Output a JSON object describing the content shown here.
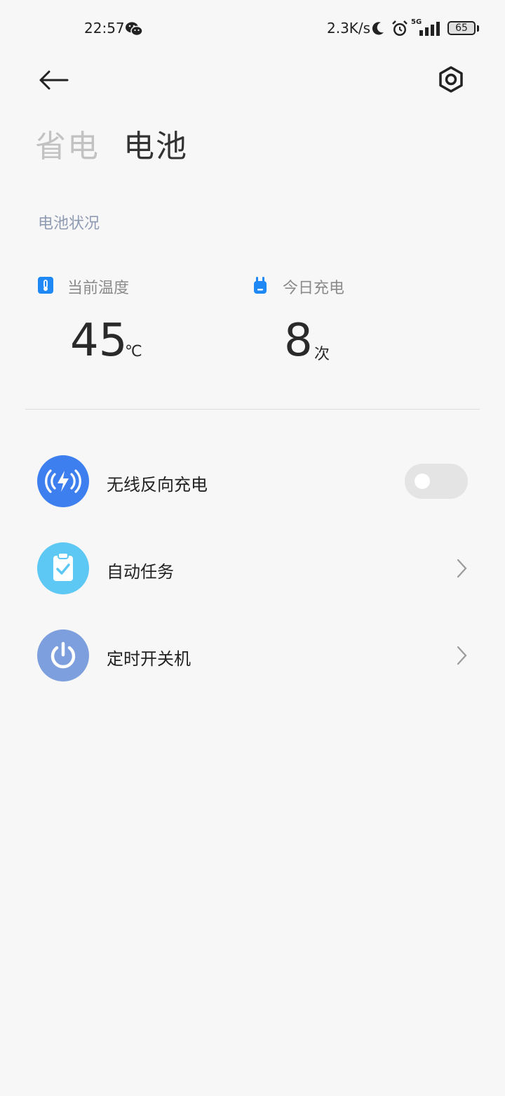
{
  "status_bar": {
    "time": "22:57",
    "net_speed": "2.3K/s",
    "network_type": "5G",
    "battery_level": "65",
    "icons": [
      "wechat-icon",
      "moon-icon",
      "alarm-icon",
      "signal-icon",
      "battery-icon"
    ]
  },
  "header": {
    "tabs": [
      {
        "label": "省电",
        "active": false
      },
      {
        "label": "电池",
        "active": true
      }
    ],
    "back_icon": "arrow-left-icon",
    "settings_icon": "settings-hex-icon"
  },
  "battery_status": {
    "section_title": "电池状况",
    "temperature": {
      "label": "当前温度",
      "value": "45",
      "unit": "℃",
      "icon": "thermometer-icon",
      "accent": "#1e88f5"
    },
    "charges_today": {
      "label": "今日充电",
      "value": "8",
      "unit": "次",
      "icon": "plug-icon",
      "accent": "#1e88f5"
    }
  },
  "options": [
    {
      "label": "无线反向充电",
      "icon": "wireless-charge-icon",
      "color": "#3e7ff0",
      "control": "toggle",
      "toggle_on": false
    },
    {
      "label": "自动任务",
      "icon": "clipboard-check-icon",
      "color": "#5ec8f5",
      "control": "chevron"
    },
    {
      "label": "定时开关机",
      "icon": "power-icon",
      "color": "#7d9fdd",
      "control": "chevron"
    }
  ]
}
